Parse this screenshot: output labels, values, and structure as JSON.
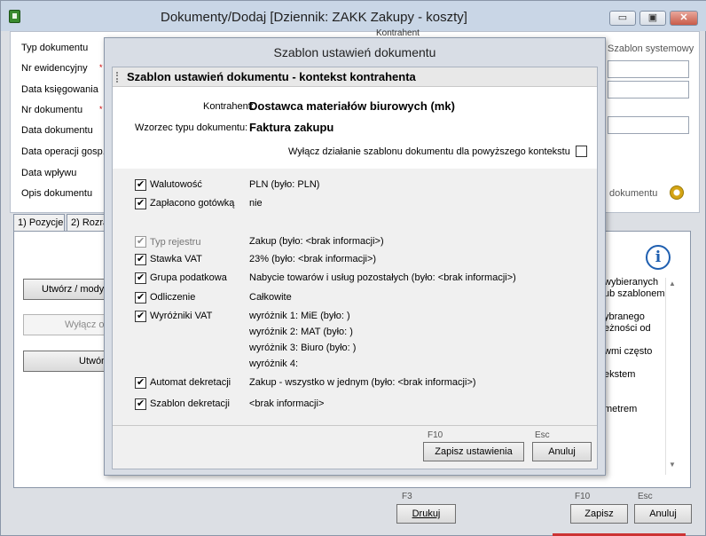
{
  "window": {
    "title": "Dokumenty/Dodaj [Dziennik: ZAKK  Zakupy - koszty]",
    "min_icon": "▭",
    "max_icon": "▣",
    "close_icon": "✕"
  },
  "form": {
    "labels": {
      "typ": "Typ dokumentu",
      "nr_ewid": "Nr ewidencyjny",
      "data_ksieg": "Data księgowania",
      "nr_dok": "Nr dokumentu",
      "data_dok": "Data dokumentu",
      "data_oper": "Data operacji gosp.",
      "data_wplywu": "Data wpływu",
      "opis": "Opis dokumentu"
    },
    "required_mark": "*",
    "kontrahent_label": "Kontrahent",
    "szablon_systemowy": "Szablon systemowy",
    "dokumentu_link": "dokumentu"
  },
  "tabs": [
    "1) Pozycje",
    "2) Rozra"
  ],
  "left_buttons": {
    "create_modify": "Utwórz / mody",
    "disable": "Wyłącz o",
    "create": "Utwór"
  },
  "right_texts": [
    "wybieranych",
    "ub szablonem",
    "ybranego",
    "eżności od",
    "wmi często",
    "ekstem",
    "metrem"
  ],
  "bottom": {
    "f3": "F3",
    "print": "Drukuj",
    "f10": "F10",
    "save": "Zapisz",
    "esc": "Esc",
    "cancel": "Anuluj"
  },
  "modal": {
    "title": "Szablon ustawień dokumentu",
    "section": "Szablon ustawień dokumentu - kontekst kontrahenta",
    "kontrahent_label": "Kontrahent:",
    "kontrahent_value": "Dostawca materiałów biurowych (mk)",
    "wzorzec_label": "Wzorzec typu dokumentu:",
    "wzorzec_value": "Faktura zakupu",
    "disable_label": "Wyłącz działanie szablonu dokumentu dla powyższego kontekstu",
    "rows": {
      "waluta": {
        "label": "Walutowość",
        "value": "PLN (było: PLN)"
      },
      "gotowka": {
        "label": "Zapłacono gotówką",
        "value": "nie"
      },
      "typ_rej": {
        "label": "Typ rejestru",
        "value": "Zakup (było: <brak informacji>)"
      },
      "stawka": {
        "label": "Stawka VAT",
        "value": "23%  (było: <brak informacji>)"
      },
      "grupa": {
        "label": "Grupa podatkowa",
        "value": "Nabycie towarów i usług pozostałych (było: <brak informacji>)"
      },
      "odlicz": {
        "label": "Odliczenie",
        "value": "Całkowite"
      },
      "wyrozniki": {
        "label": "Wyróżniki VAT",
        "values": [
          "wyróżnik 1: MiE (było: )",
          "wyróżnik 2: MAT (było: )",
          "wyróżnik 3: Biuro (było: )",
          "wyróżnik 4:"
        ]
      },
      "automat": {
        "label": "Automat dekretacji",
        "value": "Zakup - wszystko w jednym (było: <brak informacji>)"
      },
      "szablon": {
        "label": "Szablon dekretacji",
        "value": "<brak informacji>"
      }
    },
    "f10": "F10",
    "save_settings": "Zapisz ustawienia",
    "esc": "Esc",
    "cancel": "Anuluj"
  }
}
